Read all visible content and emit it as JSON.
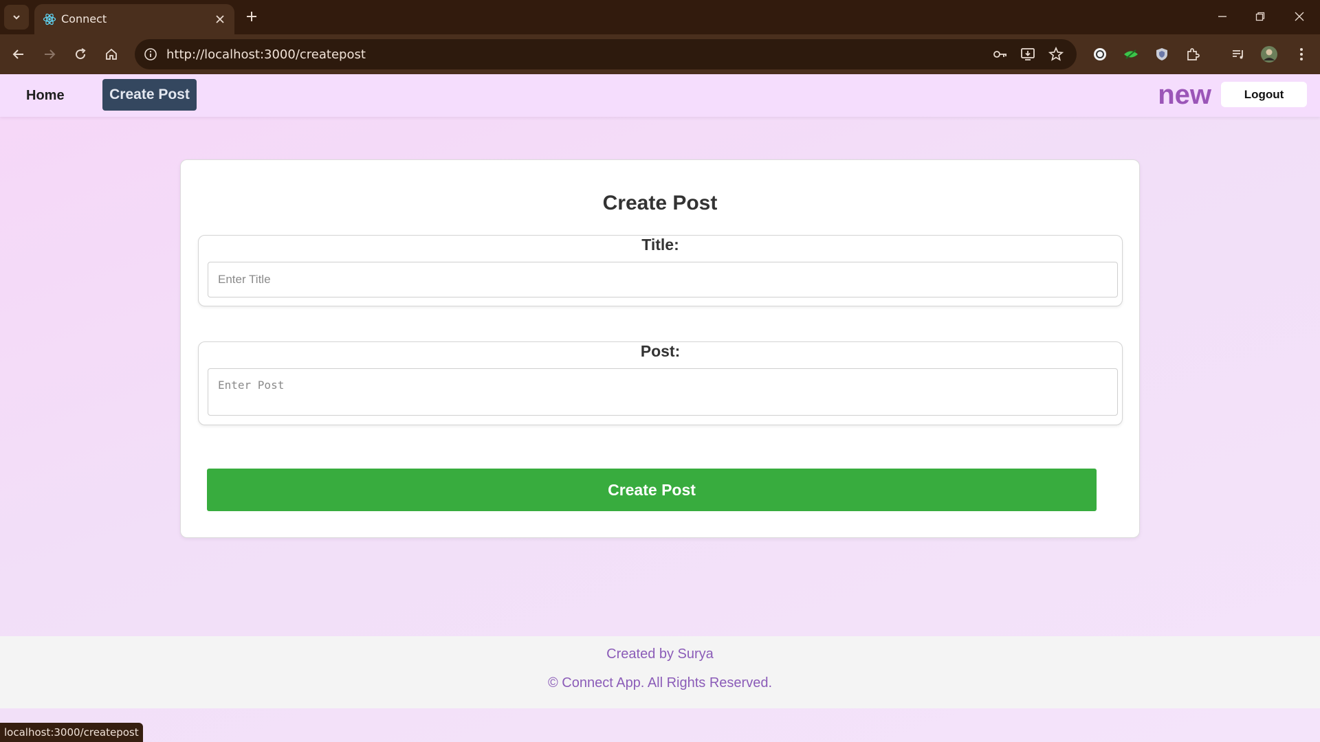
{
  "browser": {
    "tab_title": "Connect",
    "url": "http://localhost:3000/createpost",
    "status_url": "localhost:3000/createpost",
    "colors": {
      "chrome": "#321b0d",
      "toolbar": "#4a2f1d"
    }
  },
  "nav": {
    "home": "Home",
    "create_post": "Create Post",
    "username": "new",
    "logout": "Logout"
  },
  "form": {
    "heading": "Create Post",
    "title_label": "Title:",
    "title_placeholder": "Enter Title",
    "post_label": "Post:",
    "post_placeholder": "Enter Post",
    "submit": "Create Post"
  },
  "footer": {
    "credit": "Created by Surya",
    "copyright": "© Connect App. All Rights Reserved."
  },
  "theme": {
    "accent_purple": "#9b55b8",
    "submit_green": "#38ac3e",
    "nav_active": "#34475f"
  }
}
